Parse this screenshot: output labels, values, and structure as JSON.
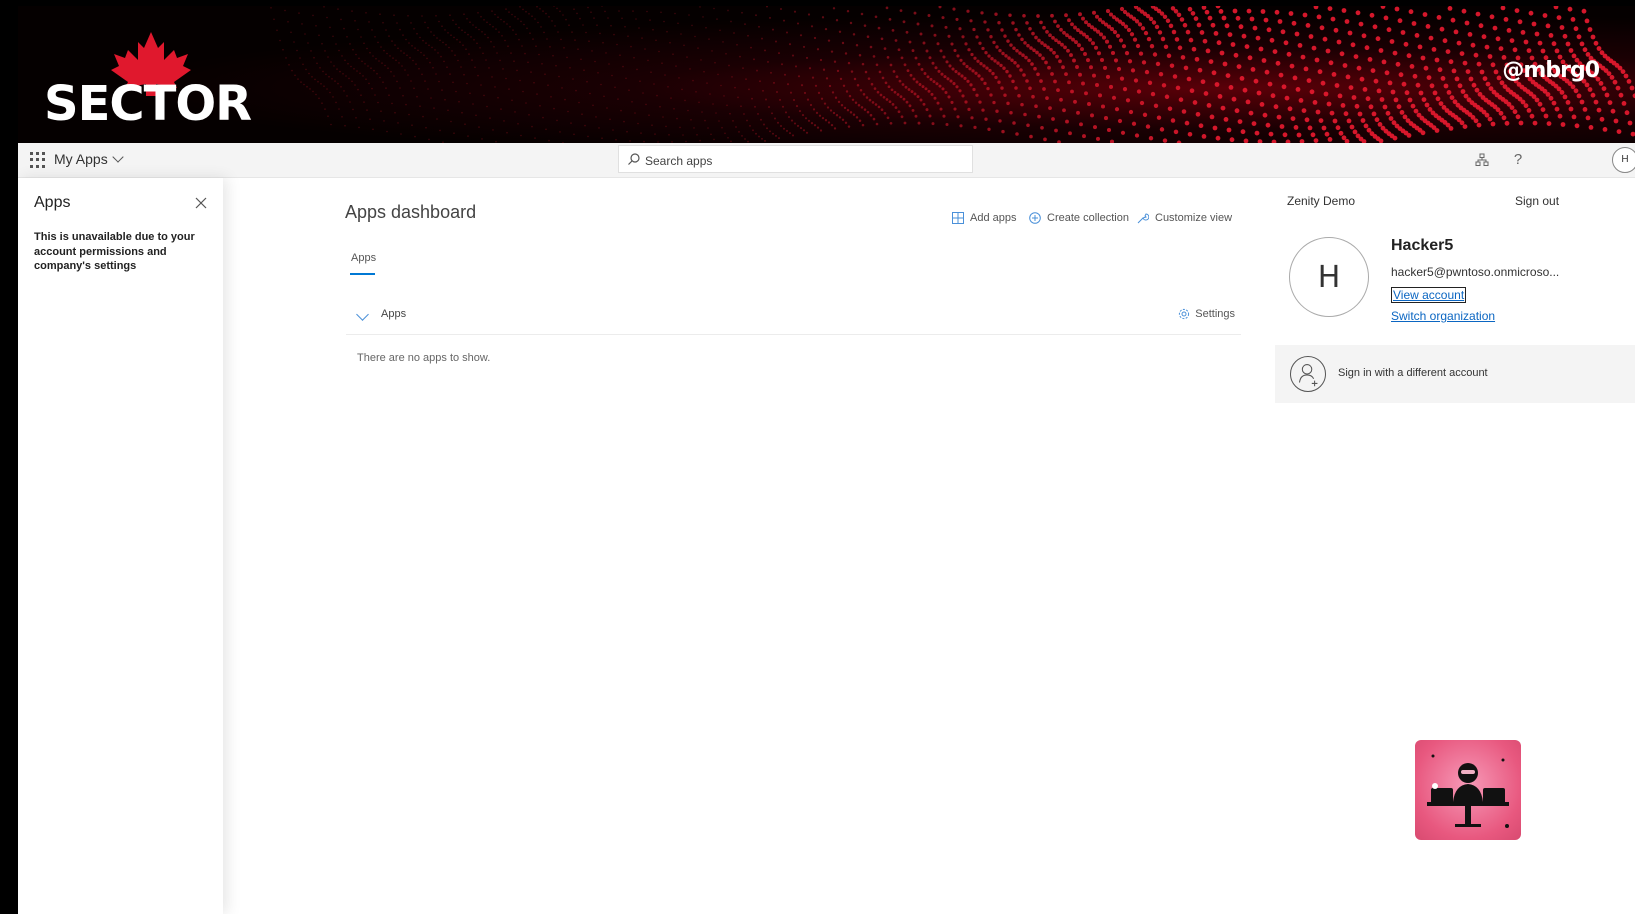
{
  "banner": {
    "logo_text": "SECTOR",
    "handle": "@mbrg0",
    "colors": {
      "accent": "#e0182d",
      "background": "#050000"
    }
  },
  "topbar": {
    "app_name": "My Apps",
    "search": {
      "placeholder": "Search apps"
    },
    "icons": [
      "waffle-icon",
      "chevron-down-icon",
      "search-icon",
      "organization-icon",
      "help-icon"
    ],
    "avatar_initial": "H"
  },
  "left_panel": {
    "title": "Apps",
    "message": "This is unavailable due to your account permissions and company's settings"
  },
  "main": {
    "title": "Apps dashboard",
    "actions": {
      "add_apps": "Add apps",
      "create_collection": "Create collection",
      "customize_view": "Customize view"
    },
    "tabs": [
      {
        "label": "Apps",
        "active": true
      }
    ],
    "group": {
      "label": "Apps",
      "settings_label": "Settings"
    },
    "empty_message": "There are no apps to show."
  },
  "account": {
    "tenant": "Zenity Demo",
    "sign_out": "Sign out",
    "initial": "H",
    "name": "Hacker5",
    "email": "hacker5@pwntoso.onmicroso...",
    "view_account": "View account",
    "switch_org": "Switch organization",
    "different_account": "Sign in with a different account"
  },
  "colors": {
    "link": "#0b66c2",
    "tab_accent": "#0078d4",
    "sticker": "#e8587f"
  }
}
